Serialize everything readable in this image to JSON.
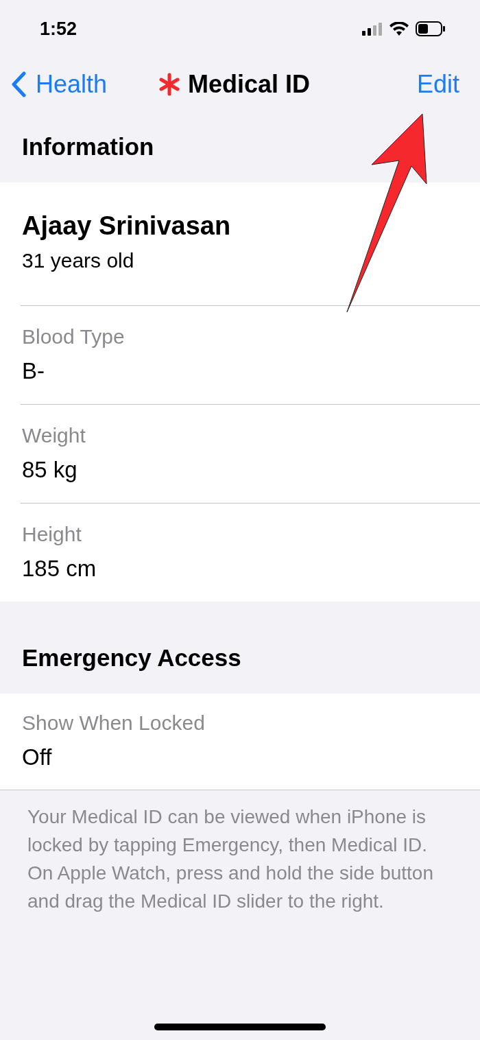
{
  "status_bar": {
    "time": "1:52"
  },
  "nav": {
    "back_label": "Health",
    "title": "Medical ID",
    "action": "Edit"
  },
  "sections": [
    {
      "header": "Information",
      "profile": {
        "name": "Ajaay Srinivasan",
        "age": "31 years old"
      },
      "fields": [
        {
          "label": "Blood Type",
          "value": "B-"
        },
        {
          "label": "Weight",
          "value": "85 kg"
        },
        {
          "label": "Height",
          "value": "185 cm"
        }
      ]
    },
    {
      "header": "Emergency Access",
      "fields": [
        {
          "label": "Show When Locked",
          "value": "Off"
        }
      ],
      "footer": "Your Medical ID can be viewed when iPhone is locked by tapping Emergency, then Medical ID. On Apple Watch, press and hold the side button and drag the Medical ID slider to the right."
    }
  ]
}
